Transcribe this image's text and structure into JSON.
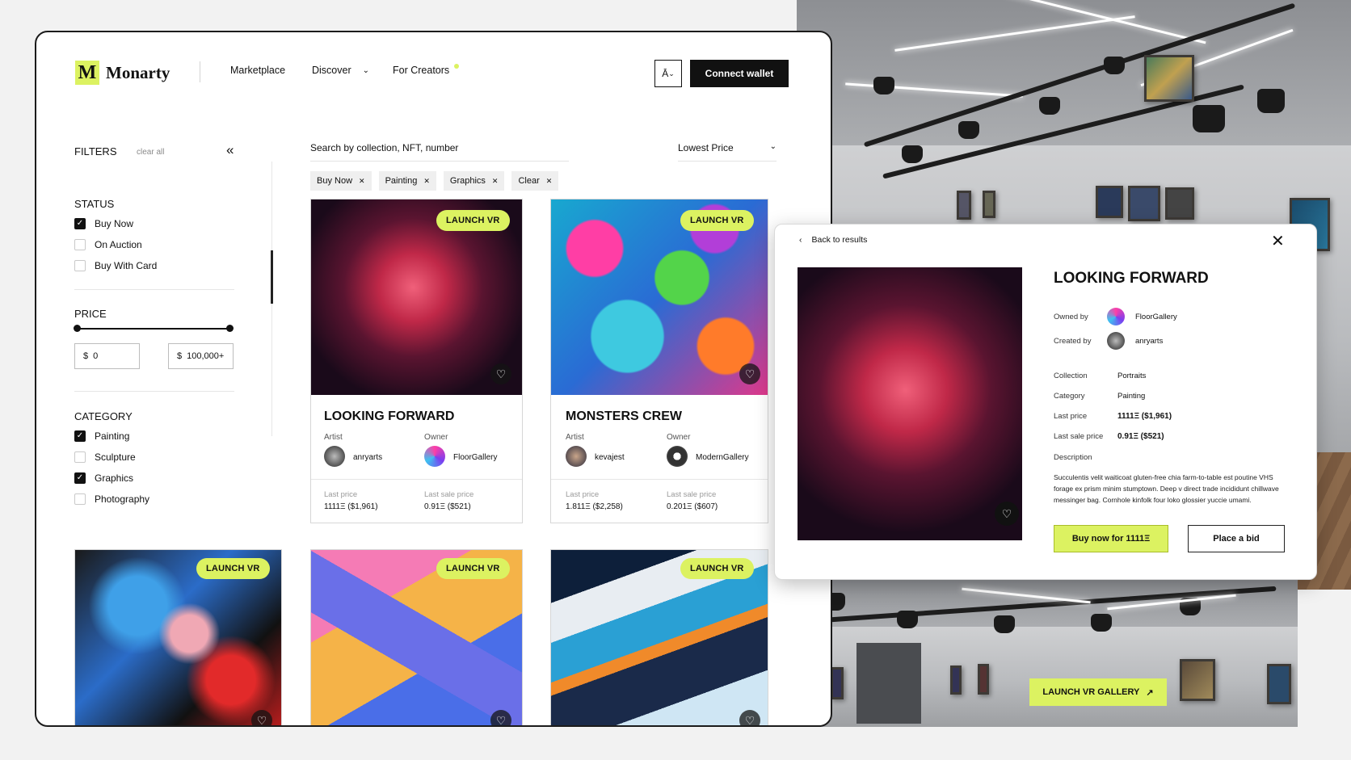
{
  "brand": {
    "mark": "M",
    "name": "Monarty"
  },
  "nav": {
    "marketplace": "Marketplace",
    "discover": "Discover",
    "creators": "For Creators"
  },
  "header": {
    "lang_glyph": "Ā",
    "connect": "Connect wallet"
  },
  "filters": {
    "title": "FILTERS",
    "clear_all": "clear all",
    "collapse_glyph": "«",
    "status": {
      "title": "STATUS",
      "items": [
        {
          "label": "Buy Now",
          "checked": true
        },
        {
          "label": "On Auction",
          "checked": false
        },
        {
          "label": "Buy With Card",
          "checked": false
        }
      ]
    },
    "price": {
      "title": "PRICE",
      "currency": "$",
      "min": "0",
      "max": "100,000+"
    },
    "category": {
      "title": "CATEGORY",
      "items": [
        {
          "label": "Painting",
          "checked": true
        },
        {
          "label": "Sculpture",
          "checked": false
        },
        {
          "label": "Graphics",
          "checked": true
        },
        {
          "label": "Photography",
          "checked": false
        }
      ]
    }
  },
  "search": {
    "placeholder": "Search by collection, NFT, number"
  },
  "sort": {
    "selected": "Lowest Price"
  },
  "chips": [
    "Buy Now",
    "Painting",
    "Graphics",
    "Clear"
  ],
  "cards": [
    {
      "badge": "LAUNCH VR",
      "title": "LOOKING FORWARD",
      "artist_label": "Artist",
      "artist": "anryarts",
      "owner_label": "Owner",
      "owner": "FloorGallery",
      "last_label": "Last price",
      "last": "1111Ξ ($1,961)",
      "sale_label": "Last sale price",
      "sale": "0.91Ξ ($521)"
    },
    {
      "badge": "LAUNCH VR",
      "title": "MONSTERS CREW",
      "artist_label": "Artist",
      "artist": "kevajest",
      "owner_label": "Owner",
      "owner": "ModernGallery",
      "last_label": "Last price",
      "last": "1.811Ξ ($2,258)",
      "sale_label": "Last sale price",
      "sale": "0.201Ξ ($607)"
    },
    {
      "badge": "LAUNCH VR"
    },
    {
      "badge": "LAUNCH VR"
    },
    {
      "badge": "LAUNCH VR"
    }
  ],
  "modal": {
    "back": "Back to results",
    "title": "LOOKING FORWARD",
    "owned_by_label": "Owned by",
    "owned_by": "FloorGallery",
    "created_by_label": "Created by",
    "created_by": "anryarts",
    "collection_label": "Collection",
    "collection": "Portraits",
    "category_label": "Category",
    "category": "Painting",
    "last_price_label": "Last price",
    "last_price": "1111Ξ ($1,961)",
    "last_sale_label": "Last sale price",
    "last_sale": "0.91Ξ ($521)",
    "description_label": "Description",
    "description": "Succulentis velit waiticoat gluten-free chia farm-to-table est poutine VHS forage ex prism minim stumptown. Deep v direct trade incididunt chillwave messinger bag. Cornhole kinfolk four loko glossier yuccie umami.",
    "buy": "Buy now for 1111Ξ",
    "bid": "Place a bid"
  },
  "gallery": {
    "launch": "LAUNCH VR GALLERY"
  },
  "colors": {
    "accent": "#dcf261",
    "dark": "#111111"
  }
}
